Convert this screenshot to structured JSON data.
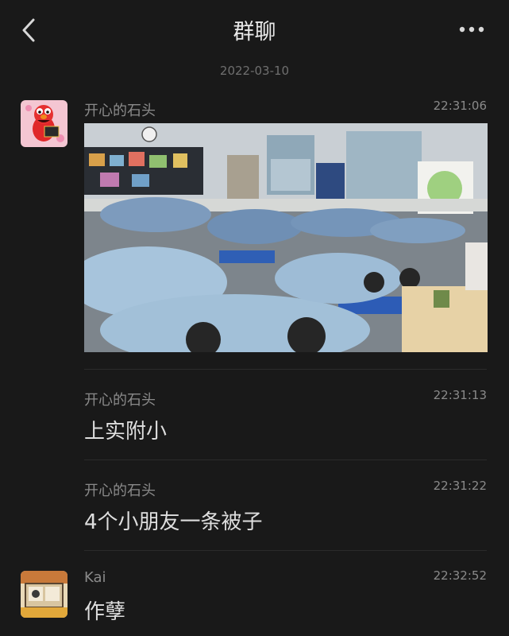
{
  "header": {
    "title": "群聊"
  },
  "date_separator": "2022-03-10",
  "messages": [
    {
      "sender": "开心的石头",
      "time": "22:31:06",
      "type": "image",
      "avatar": "elmo-avatar"
    },
    {
      "sender": "开心的石头",
      "time": "22:31:13",
      "type": "text",
      "text": "上实附小"
    },
    {
      "sender": "开心的石头",
      "time": "22:31:22",
      "type": "text",
      "text": "4个小朋友一条被子"
    },
    {
      "sender": "Kai",
      "time": "22:32:52",
      "type": "text",
      "text": "作孽",
      "avatar": "cartoon-avatar"
    }
  ],
  "icons": {
    "back": "back-chevron-icon",
    "more": "more-dots-icon"
  },
  "colors": {
    "background": "#191919",
    "text": "#dedede",
    "muted": "#8a8a8a"
  }
}
